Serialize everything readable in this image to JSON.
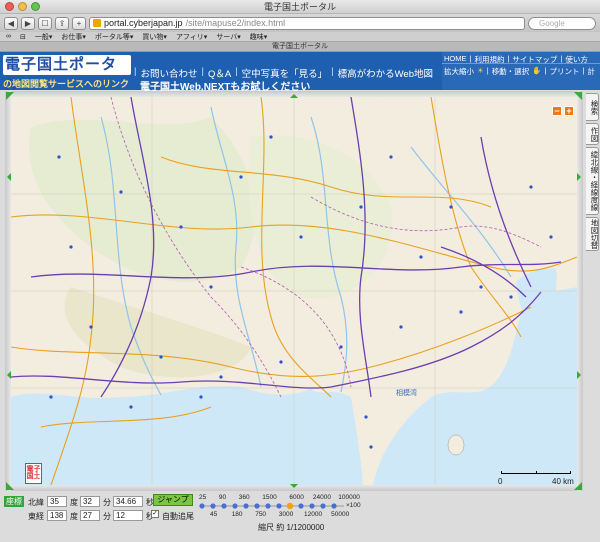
{
  "window": {
    "title": "電子国土ポータル",
    "tab_title": "電子国土ポータル"
  },
  "toolbar": {
    "back": "◀",
    "forward": "▶",
    "reader": "☐",
    "share": "⇪",
    "add": "+",
    "url_host": "portal.cyberjapan.jp",
    "url_path": "/site/mapuse2/index.html",
    "search_placeholder": "Google"
  },
  "bookmarks": [
    "∞",
    "⊟",
    "一般▾",
    "お仕事▾",
    "ポータル等▾",
    "買い物▾",
    "アフィリ▾",
    "サーバ▾",
    "趣味▾"
  ],
  "header": {
    "logo": "電子国土ポータル",
    "sublink": "の地図閲覧サービスへのリンク",
    "links": [
      "お問い合わせ",
      "Q＆A",
      "空中写真を「見る」",
      "標高がわかるWeb地図"
    ],
    "link2": "電子国土Web.NEXTもお試しください",
    "nav_top": [
      "HOME",
      "利用規約",
      "サイトマップ",
      "使い方"
    ],
    "nav_bottom": [
      "拡大縮小",
      "移動・選択",
      "プリント",
      "計"
    ]
  },
  "map": {
    "zoom_in": "+",
    "zoom_out": "−",
    "stamp": "電子国土",
    "bay_label": "相模湾",
    "scale_start": "0",
    "scale_end": "40 km",
    "colors": {
      "land": "#f3ede0",
      "sea": "#cfe8f7",
      "road": "#e8a020",
      "rail": "#6a3fb0",
      "water": "#9fd0f0"
    }
  },
  "sidetabs": [
    "検索",
    "作図",
    "緯北線・経線度線",
    "地図切替"
  ],
  "controls": {
    "coord_btn": "座標",
    "lat_label": "北緯",
    "lat_deg": "35",
    "lat_min": "32",
    "lat_sec": "34.66",
    "lon_label": "東経",
    "lon_deg": "138",
    "lon_min": "27",
    "lon_sec": "12",
    "deg": "度",
    "min": "分",
    "sec": "秒",
    "jump": "ジャンプ",
    "auto_follow": "自動追尾",
    "zoom_top": [
      "25",
      "90",
      "360",
      "1500",
      "6000",
      "24000",
      "100000"
    ],
    "zoom_bottom": [
      "45",
      "180",
      "750",
      "3000",
      "12000",
      "50000"
    ],
    "zoom_unit": "×100",
    "scale_label": "縮尺 約 1/1200000"
  }
}
